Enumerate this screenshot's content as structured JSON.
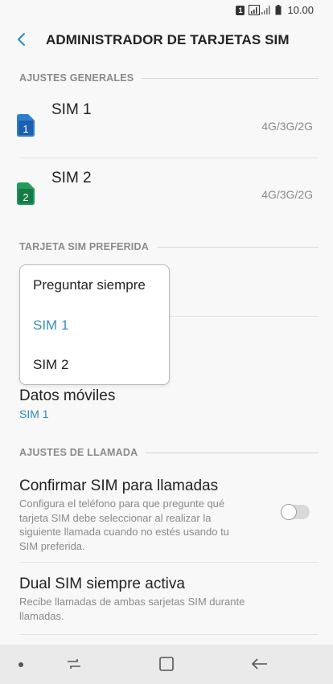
{
  "status_bar": {
    "sim_indicator": "1",
    "time": "10.00",
    "icons": [
      "sim-badge-icon",
      "signal-icon",
      "battery-icon"
    ]
  },
  "header": {
    "title": "ADMINISTRADOR DE TARJETAS SIM",
    "back_icon": "back-arrow-icon"
  },
  "sections": {
    "general": "AJUSTES GENERALES",
    "preferred": "TARJETA SIM PREFERIDA",
    "calls": "AJUSTES DE LLAMADA"
  },
  "sim_cards": [
    {
      "name": "SIM 1",
      "tech": "4G/3G/2G",
      "badge": "1",
      "color": "#2d7fd3"
    },
    {
      "name": "SIM 2",
      "tech": "4G/3G/2G",
      "badge": "2",
      "color": "#1f9c5a"
    }
  ],
  "popup": {
    "options": [
      {
        "label": "Preguntar siempre",
        "selected": false
      },
      {
        "label": "SIM 1",
        "selected": true
      },
      {
        "label": "SIM 2",
        "selected": false
      }
    ]
  },
  "mobile_data": {
    "title": "Datos móviles",
    "value": "SIM 1"
  },
  "confirm_sim": {
    "title": "Confirmar SIM para llamadas",
    "desc_lines": [
      "Configura el teléfono para que pregunte qué",
      "tarjeta SIM debe seleccionar al realizar la",
      "siguiente llamada cuando no estés usando tu",
      "SIM preferida."
    ],
    "enabled": false
  },
  "dual_sim": {
    "title": "Dual SIM siempre activa",
    "desc_lines": [
      "Recibe llamadas de ambas sarjetas SIM durante",
      "llamadas."
    ]
  },
  "navbar": {
    "icons": [
      "nav-dot-icon",
      "recents-icon",
      "home-icon",
      "back-icon"
    ]
  },
  "colors": {
    "accent": "#2a8bc4",
    "selected": "#3a8fb7",
    "background": "#f8f8f8"
  }
}
